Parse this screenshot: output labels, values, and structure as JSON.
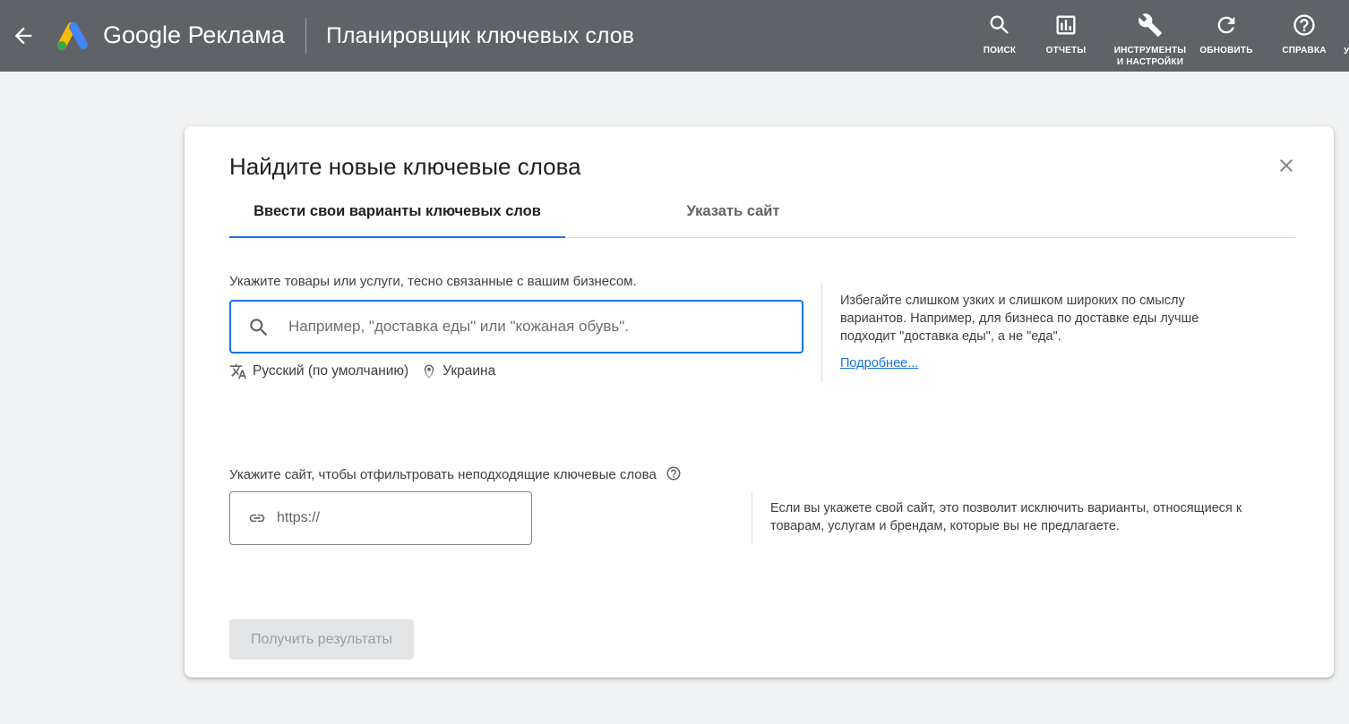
{
  "header": {
    "brand": "Google Реклама",
    "title": "Планировщик ключевых слов",
    "actions": [
      {
        "icon": "search-icon",
        "label": "ПОИСК"
      },
      {
        "icon": "reports-icon",
        "label": "ОТЧЕТЫ"
      },
      {
        "icon": "wrench-icon",
        "label_line1": "ИНСТРУМЕНТЫ",
        "label_line2": "И НАСТРОЙКИ"
      },
      {
        "icon": "refresh-icon",
        "label": "ОБНОВИТЬ"
      },
      {
        "icon": "help-icon",
        "label": "СПРАВКА"
      }
    ],
    "cut_label": "У"
  },
  "dialog": {
    "title": "Найдите новые ключевые слова",
    "tabs": [
      {
        "label": "Ввести свои варианты ключевых слов",
        "active": true
      },
      {
        "label": "Указать сайт",
        "active": false
      }
    ],
    "keywords": {
      "label": "Укажите товары или услуги, тесно связанные с вашим бизнесом.",
      "placeholder": "Например, \"доставка еды\" или \"кожаная обувь\".",
      "value": "",
      "language": "Русский (по умолчанию)",
      "location": "Украина",
      "help": "Избегайте слишком узких и слишком широких по смыслу вариантов. Например, для бизнеса по доставке еды лучше подходит \"доставка еды\", а не \"еда\".",
      "help_link": "Подробнее..."
    },
    "site": {
      "label": "Укажите сайт, чтобы отфильтровать неподходящие ключевые слова",
      "placeholder": "https://",
      "value": "",
      "help": "Если вы укажете свой сайт, это позволит исключить варианты, относящиеся к товарам, услугам и брендам, которые вы не предлагаете."
    },
    "submit_label": "Получить результаты",
    "submit_enabled": false
  },
  "colors": {
    "header_bg": "#5f6368",
    "page_bg": "#f1f3f4",
    "accent": "#1a73e8",
    "disabled_button_bg": "#e3e5e7",
    "disabled_button_text": "#9aa0a6"
  }
}
